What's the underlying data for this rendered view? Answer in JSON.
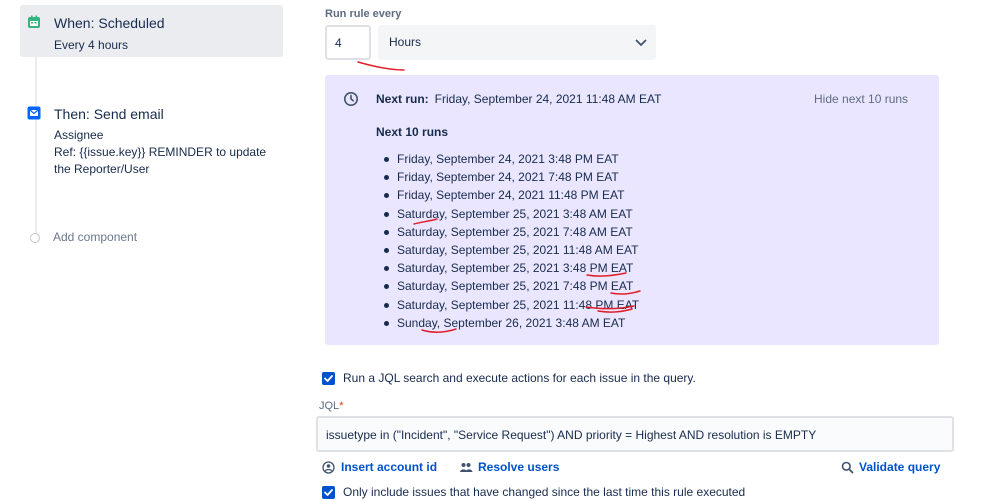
{
  "flow": {
    "trigger": {
      "title": "When: Scheduled",
      "subtitle": "Every 4 hours",
      "icon": "calendar-icon"
    },
    "action": {
      "title": "Then: Send email",
      "line1": "Assignee",
      "line2": "Ref: {{issue.key}} REMINDER to update the Reporter/User",
      "icon": "mail-icon"
    },
    "add_component": "Add component"
  },
  "schedule": {
    "run_label": "Run rule every",
    "interval_value": "4",
    "unit": "Hours"
  },
  "runs": {
    "next_run_label": "Next run:",
    "next_run_value": "Friday, September 24, 2021 11:48 AM EAT",
    "hide_link": "Hide next 10 runs",
    "list_title": "Next 10 runs",
    "items": [
      "Friday, September 24, 2021 3:48 PM EAT",
      "Friday, September 24, 2021 7:48 PM EAT",
      "Friday, September 24, 2021 11:48 PM EAT",
      "Saturday, September 25, 2021 3:48 AM EAT",
      "Saturday, September 25, 2021 7:48 AM EAT",
      "Saturday, September 25, 2021 11:48 AM EAT",
      "Saturday, September 25, 2021 3:48 PM EAT",
      "Saturday, September 25, 2021 7:48 PM EAT",
      "Saturday, September 25, 2021 11:48 PM EAT",
      "Sunday, September 26, 2021 3:48 AM EAT"
    ]
  },
  "jql_option": {
    "label": "Run a JQL search and execute actions for each issue in the query.",
    "checked": true
  },
  "jql": {
    "label": "JQL",
    "required_mark": "*",
    "value": "issuetype in (\"Incident\", \"Service Request\") AND priority = Highest AND resolution is EMPTY"
  },
  "tools": {
    "insert_account": "Insert account id",
    "resolve_users": "Resolve users",
    "validate": "Validate query"
  },
  "changed_option": {
    "label": "Only include issues that have changed since the last time this rule executed",
    "checked": true
  },
  "colors": {
    "accent": "#0052cc",
    "panel_bg": "#eae6ff",
    "annotation": "#e01e2b"
  }
}
